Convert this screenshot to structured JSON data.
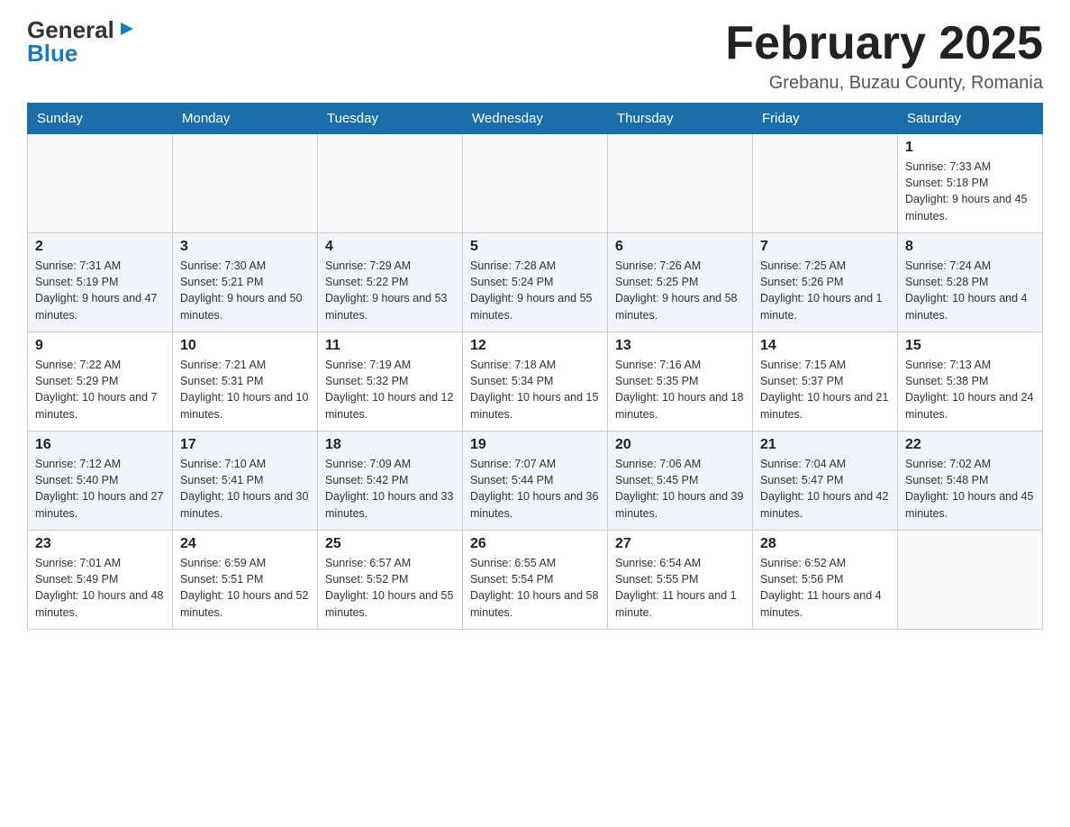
{
  "header": {
    "logo_general": "General",
    "logo_blue": "Blue",
    "main_title": "February 2025",
    "subtitle": "Grebanu, Buzau County, Romania"
  },
  "calendar": {
    "days_of_week": [
      "Sunday",
      "Monday",
      "Tuesday",
      "Wednesday",
      "Thursday",
      "Friday",
      "Saturday"
    ],
    "weeks": [
      [
        {
          "day": "",
          "info": ""
        },
        {
          "day": "",
          "info": ""
        },
        {
          "day": "",
          "info": ""
        },
        {
          "day": "",
          "info": ""
        },
        {
          "day": "",
          "info": ""
        },
        {
          "day": "",
          "info": ""
        },
        {
          "day": "1",
          "info": "Sunrise: 7:33 AM\nSunset: 5:18 PM\nDaylight: 9 hours and 45 minutes."
        }
      ],
      [
        {
          "day": "2",
          "info": "Sunrise: 7:31 AM\nSunset: 5:19 PM\nDaylight: 9 hours and 47 minutes."
        },
        {
          "day": "3",
          "info": "Sunrise: 7:30 AM\nSunset: 5:21 PM\nDaylight: 9 hours and 50 minutes."
        },
        {
          "day": "4",
          "info": "Sunrise: 7:29 AM\nSunset: 5:22 PM\nDaylight: 9 hours and 53 minutes."
        },
        {
          "day": "5",
          "info": "Sunrise: 7:28 AM\nSunset: 5:24 PM\nDaylight: 9 hours and 55 minutes."
        },
        {
          "day": "6",
          "info": "Sunrise: 7:26 AM\nSunset: 5:25 PM\nDaylight: 9 hours and 58 minutes."
        },
        {
          "day": "7",
          "info": "Sunrise: 7:25 AM\nSunset: 5:26 PM\nDaylight: 10 hours and 1 minute."
        },
        {
          "day": "8",
          "info": "Sunrise: 7:24 AM\nSunset: 5:28 PM\nDaylight: 10 hours and 4 minutes."
        }
      ],
      [
        {
          "day": "9",
          "info": "Sunrise: 7:22 AM\nSunset: 5:29 PM\nDaylight: 10 hours and 7 minutes."
        },
        {
          "day": "10",
          "info": "Sunrise: 7:21 AM\nSunset: 5:31 PM\nDaylight: 10 hours and 10 minutes."
        },
        {
          "day": "11",
          "info": "Sunrise: 7:19 AM\nSunset: 5:32 PM\nDaylight: 10 hours and 12 minutes."
        },
        {
          "day": "12",
          "info": "Sunrise: 7:18 AM\nSunset: 5:34 PM\nDaylight: 10 hours and 15 minutes."
        },
        {
          "day": "13",
          "info": "Sunrise: 7:16 AM\nSunset: 5:35 PM\nDaylight: 10 hours and 18 minutes."
        },
        {
          "day": "14",
          "info": "Sunrise: 7:15 AM\nSunset: 5:37 PM\nDaylight: 10 hours and 21 minutes."
        },
        {
          "day": "15",
          "info": "Sunrise: 7:13 AM\nSunset: 5:38 PM\nDaylight: 10 hours and 24 minutes."
        }
      ],
      [
        {
          "day": "16",
          "info": "Sunrise: 7:12 AM\nSunset: 5:40 PM\nDaylight: 10 hours and 27 minutes."
        },
        {
          "day": "17",
          "info": "Sunrise: 7:10 AM\nSunset: 5:41 PM\nDaylight: 10 hours and 30 minutes."
        },
        {
          "day": "18",
          "info": "Sunrise: 7:09 AM\nSunset: 5:42 PM\nDaylight: 10 hours and 33 minutes."
        },
        {
          "day": "19",
          "info": "Sunrise: 7:07 AM\nSunset: 5:44 PM\nDaylight: 10 hours and 36 minutes."
        },
        {
          "day": "20",
          "info": "Sunrise: 7:06 AM\nSunset: 5:45 PM\nDaylight: 10 hours and 39 minutes."
        },
        {
          "day": "21",
          "info": "Sunrise: 7:04 AM\nSunset: 5:47 PM\nDaylight: 10 hours and 42 minutes."
        },
        {
          "day": "22",
          "info": "Sunrise: 7:02 AM\nSunset: 5:48 PM\nDaylight: 10 hours and 45 minutes."
        }
      ],
      [
        {
          "day": "23",
          "info": "Sunrise: 7:01 AM\nSunset: 5:49 PM\nDaylight: 10 hours and 48 minutes."
        },
        {
          "day": "24",
          "info": "Sunrise: 6:59 AM\nSunset: 5:51 PM\nDaylight: 10 hours and 52 minutes."
        },
        {
          "day": "25",
          "info": "Sunrise: 6:57 AM\nSunset: 5:52 PM\nDaylight: 10 hours and 55 minutes."
        },
        {
          "day": "26",
          "info": "Sunrise: 6:55 AM\nSunset: 5:54 PM\nDaylight: 10 hours and 58 minutes."
        },
        {
          "day": "27",
          "info": "Sunrise: 6:54 AM\nSunset: 5:55 PM\nDaylight: 11 hours and 1 minute."
        },
        {
          "day": "28",
          "info": "Sunrise: 6:52 AM\nSunset: 5:56 PM\nDaylight: 11 hours and 4 minutes."
        },
        {
          "day": "",
          "info": ""
        }
      ]
    ]
  }
}
